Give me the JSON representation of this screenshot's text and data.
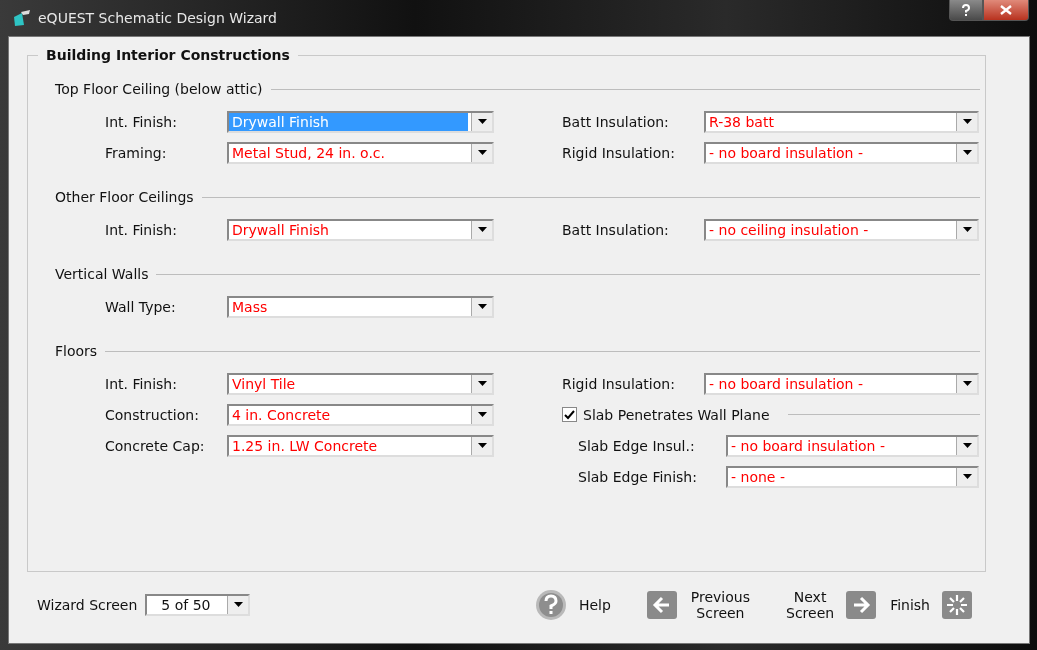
{
  "window": {
    "title": "eQUEST Schematic Design Wizard"
  },
  "group_title": "Building Interior Constructions",
  "sections": [
    {
      "title": "Top Floor Ceiling (below attic)",
      "left": [
        {
          "label": "Int. Finish:",
          "value": "Drywall Finish",
          "focused": true
        },
        {
          "label": "Framing:",
          "value": "Metal Stud, 24 in. o.c.",
          "focused": false
        }
      ],
      "right": [
        {
          "kind": "field",
          "label": "Batt Insulation:",
          "value": "R-38 batt",
          "focused": false
        },
        {
          "kind": "field",
          "label": "Rigid Insulation:",
          "value": "- no board insulation -",
          "focused": false
        }
      ]
    },
    {
      "title": "Other Floor Ceilings",
      "left": [
        {
          "label": "Int. Finish:",
          "value": "Drywall Finish",
          "focused": false
        }
      ],
      "right": [
        {
          "kind": "field",
          "label": "Batt Insulation:",
          "value": "- no ceiling insulation -",
          "focused": false
        }
      ]
    },
    {
      "title": "Vertical Walls",
      "left": [
        {
          "label": "Wall Type:",
          "value": "Mass",
          "focused": false
        }
      ]
    },
    {
      "title": "Floors",
      "left": [
        {
          "label": "Int. Finish:",
          "value": "Vinyl Tile",
          "focused": false
        },
        {
          "label": "Construction:",
          "value": "4 in. Concrete",
          "focused": false
        },
        {
          "label": "Concrete Cap:",
          "value": "1.25 in. LW Concrete",
          "focused": false
        }
      ],
      "right": [
        {
          "kind": "field",
          "label": "Rigid Insulation:",
          "value": "- no board insulation -",
          "focused": false
        },
        {
          "kind": "checkbox",
          "label": "Slab Penetrates Wall Plane",
          "checked": true
        },
        {
          "kind": "subfield",
          "label": "Slab Edge Insul.:",
          "value": "- no board insulation -",
          "focused": false
        },
        {
          "kind": "subfield",
          "label": "Slab Edge Finish:",
          "value": "- none -",
          "focused": false
        }
      ]
    }
  ],
  "footer": {
    "screen_label": "Wizard Screen",
    "screen_value": "5 of 50",
    "help": "Help",
    "previous": [
      "Previous",
      "Screen"
    ],
    "next": [
      "Next",
      "Screen"
    ],
    "finish": "Finish"
  }
}
